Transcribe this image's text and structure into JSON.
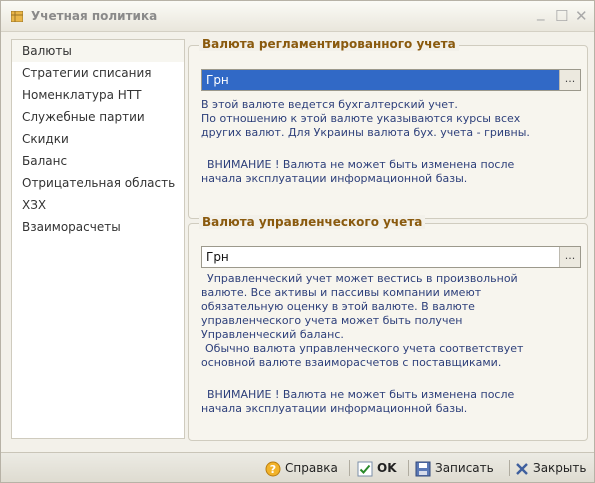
{
  "window": {
    "title": "Учетная политика"
  },
  "sidebar": {
    "items": [
      {
        "label": "Валюты"
      },
      {
        "label": "Стратегии списания"
      },
      {
        "label": "Номенклатура НТТ"
      },
      {
        "label": "Служебные партии"
      },
      {
        "label": "Скидки"
      },
      {
        "label": "Баланс"
      },
      {
        "label": "Отрицательная область"
      },
      {
        "label": "ХЗХ"
      },
      {
        "label": "Взаиморасчеты"
      }
    ]
  },
  "regulated": {
    "title": "Валюта регламентированного учета",
    "value": "Грн",
    "button": "...",
    "desc1": "В этой валюте ведется бухгалтерский учет.",
    "desc2": "По отношению к этой валюте указываются курсы всех",
    "desc3": "других валют. Для Украины валюта бух. учета - гривны.",
    "warning1": "ВНИМАНИЕ ! Валюта не может быть изменена после",
    "warning2": "начала эксплуатации информационной базы."
  },
  "management": {
    "title": "Валюта управленческого учета",
    "value": "Грн",
    "button": "...",
    "desc1": "Управленческий учет может вестись в произвольной",
    "desc2": "валюте. Все активы и пассивы компании имеют",
    "desc3": "обязательную оценку в этой валюте. В валюте",
    "desc4": "управленческого учета может быть получен",
    "desc5": "Управленческий баланс.",
    "desc6": "Обычно валюта управленческого учета соответствует",
    "desc7": "основной валюте взаиморасчетов с поставщиками.",
    "warning1": "ВНИМАНИЕ ! Валюта не может быть изменена после",
    "warning2": "начала эксплуатации информационной базы."
  },
  "footer": {
    "help": "Справка",
    "ok": "OK",
    "save": "Записать",
    "close": "Закрыть"
  },
  "colors": {
    "accent": "#3169c6",
    "group_title": "#8a5a0e",
    "description": "#2d3f7a"
  }
}
